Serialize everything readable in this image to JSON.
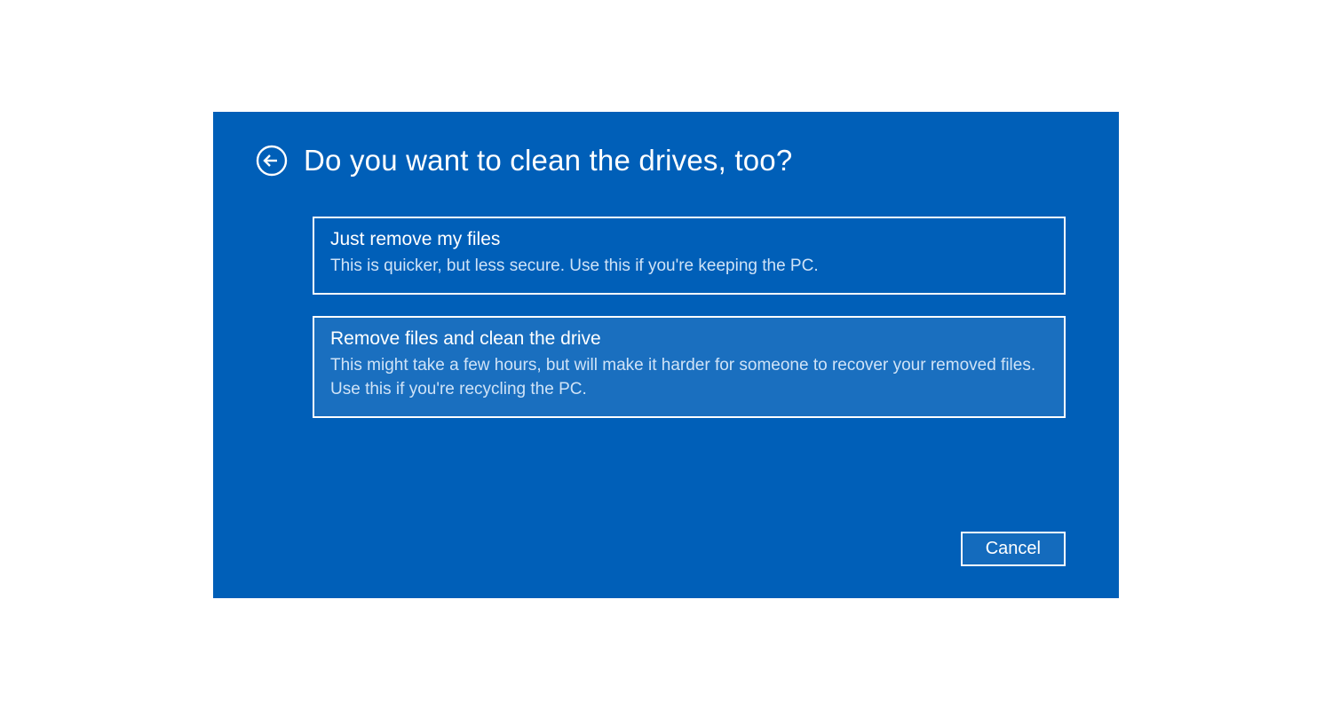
{
  "header": {
    "title": "Do you want to clean the drives, too?"
  },
  "options": [
    {
      "title": "Just remove my files",
      "description": "This is quicker, but less secure. Use this if you're keeping the PC.",
      "highlighted": false
    },
    {
      "title": "Remove files and clean the drive",
      "description": "This might take a few hours, but will make it harder for someone to recover your removed files. Use this if you're recycling the PC.",
      "highlighted": true
    }
  ],
  "footer": {
    "cancel_label": "Cancel"
  },
  "colors": {
    "dialog_bg": "#005fb8",
    "text_primary": "#ffffff",
    "text_secondary": "#cfe3f7"
  }
}
